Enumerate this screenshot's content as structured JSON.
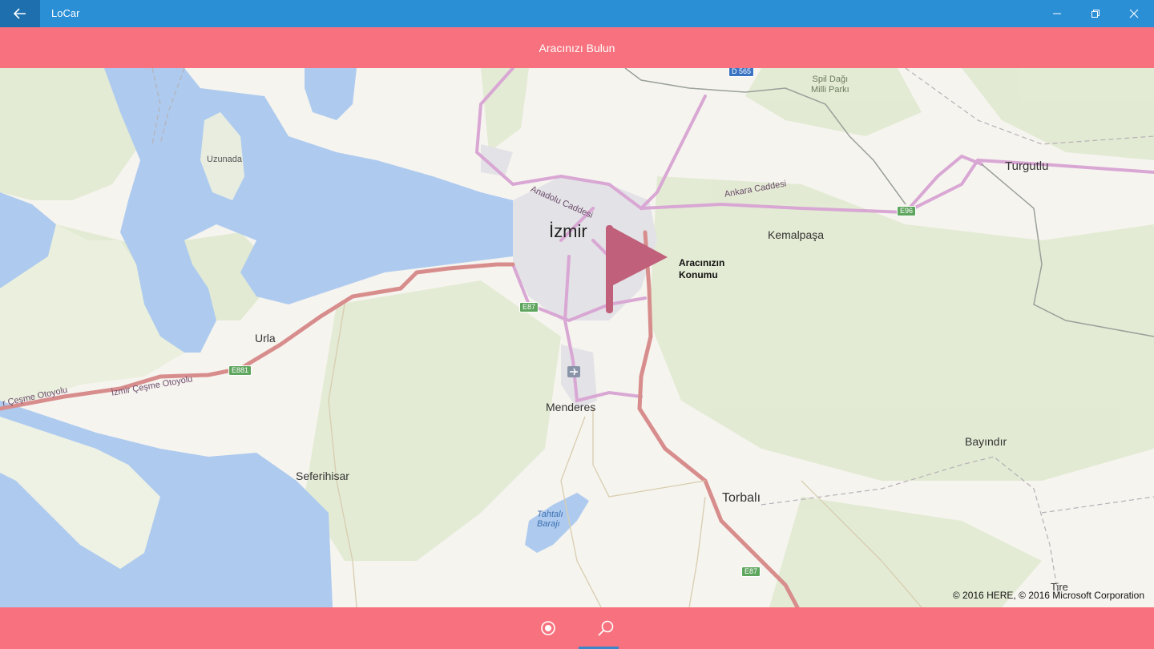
{
  "window": {
    "app_title": "LoCar",
    "titlebar_color": "#2b8fd6",
    "buttons": [
      "back-icon",
      "minimize-icon",
      "maximize-icon",
      "close-icon"
    ]
  },
  "header": {
    "title": "Aracınızı Bulun",
    "color": "#f7727e"
  },
  "map": {
    "labels": {
      "izmir": "İzmir",
      "kemalpasa": "Kemalpaşa",
      "turgutlu": "Turgutlu",
      "urla": "Urla",
      "menderes": "Menderes",
      "seferihisar": "Seferihisar",
      "torbali": "Torbalı",
      "bayindir": "Bayındır",
      "uzunada": "Uzunada",
      "tire": "Tire",
      "spil": "Spil Dağı\nMilli Parkı",
      "tahtali": "Tahtalı\nBarajı",
      "anadolu": "Anadolu Caddesi",
      "ankara": "Ankara Caddesi",
      "cesme": "İzmir Çeşme Otoyolu",
      "cesme2": "r Çeşme Otoyolu"
    },
    "shields": {
      "d565": "D 565",
      "e96": "E96",
      "e87a": "E87",
      "e87b": "E87",
      "e881": "E881"
    },
    "pin": {
      "label": "Aracınızın\nKonumu",
      "color": "#c0607a"
    },
    "copyright": "© 2016 HERE, © 2016 Microsoft Corporation"
  },
  "appbar": {
    "buttons": [
      "locate-icon",
      "search-icon"
    ],
    "color": "#f7727e"
  }
}
